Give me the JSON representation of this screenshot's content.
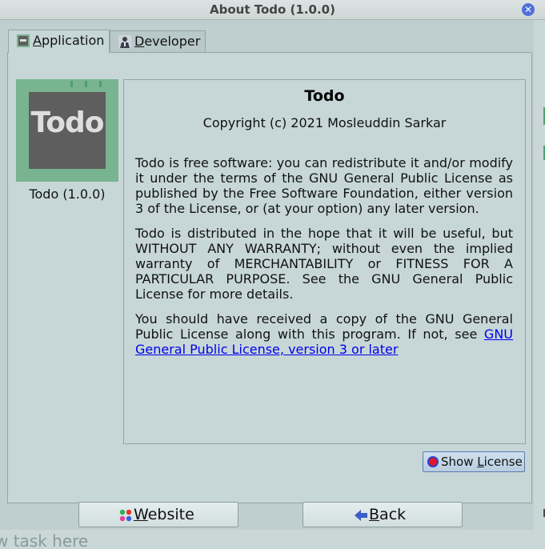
{
  "window": {
    "title": "About Todo (1.0.0)",
    "close_icon": "close-icon"
  },
  "background": {
    "partial_text": "w task here"
  },
  "tabs": [
    {
      "label_first": "A",
      "label_rest": "pplication",
      "icon": "app-icon"
    },
    {
      "label_first": "D",
      "label_rest": "eveloper",
      "icon": "developer-icon"
    }
  ],
  "app": {
    "logo_text": "Todo",
    "caption": "Todo (1.0.0)"
  },
  "about": {
    "title": "Todo",
    "copyright": "Copyright (c) 2021 Mosleuddin Sarkar",
    "paragraph1": "Todo is free software: you can redistribute it and/or modify it under the terms of the GNU General Public License as published by the Free Software Foundation, either version 3 of the License, or (at your option) any later version.",
    "paragraph2": "Todo is distributed in the hope that it will be useful, but WITHOUT ANY WARRANTY; without even the implied warranty of MERCHANTABILITY or FITNESS FOR A PARTICULAR PURPOSE. See the GNU General Public License for more details.",
    "paragraph3_text": "You should have received a copy of the GNU General Public License along with this program. If not, see ",
    "paragraph3_link": "GNU General Public License, version 3 or later"
  },
  "buttons": {
    "show_license_pre": "Show ",
    "show_license_u": "L",
    "show_license_post": "icense",
    "website_u": "W",
    "website_rest": "ebsite",
    "back_u": "B",
    "back_rest": "ack"
  },
  "colors": {
    "accent": "#4f6fd9",
    "link": "#0000ee",
    "logo_bg": "#78b48f",
    "logo_inner": "#5e5e5e"
  }
}
